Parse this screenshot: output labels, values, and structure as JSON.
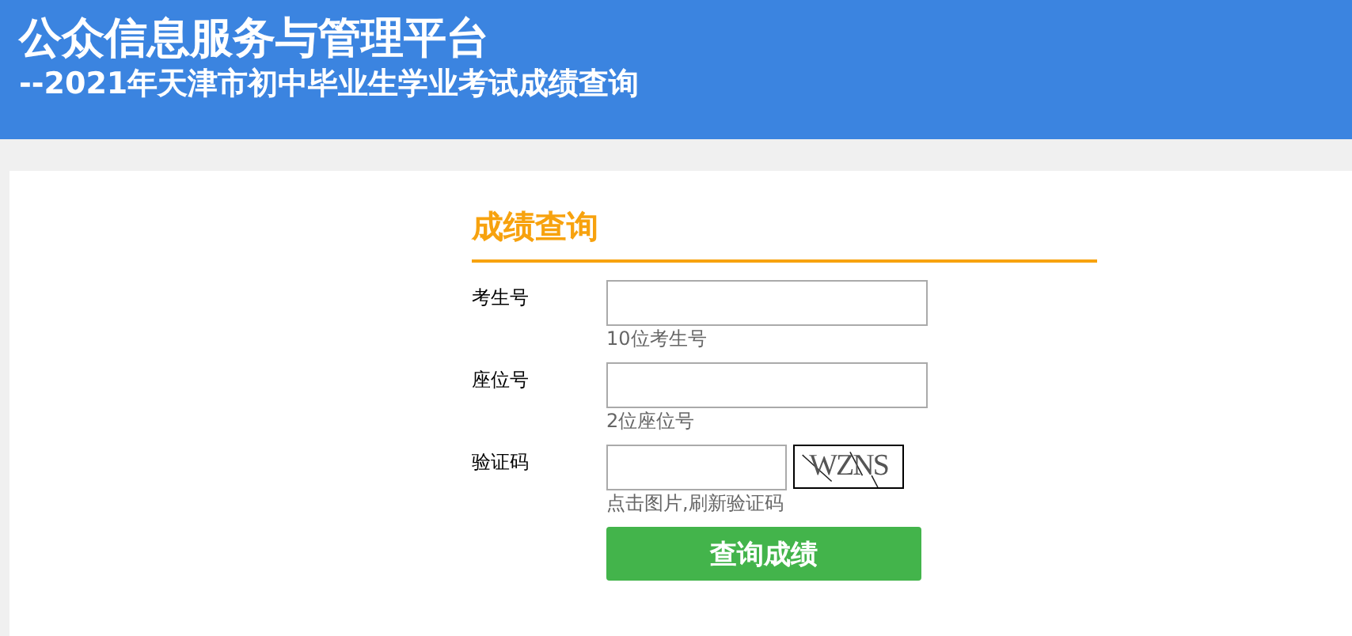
{
  "header": {
    "title": "公众信息服务与管理平台",
    "subtitle": "--2021年天津市初中毕业生学业考试成绩查询"
  },
  "form": {
    "heading": "成绩查询",
    "fields": [
      {
        "kind": "text",
        "label": "考生号",
        "hint": "10位考生号"
      },
      {
        "kind": "captcha_off",
        "label": "座位号",
        "hint": "2位座位号"
      },
      {
        "kind": "captcha",
        "label": "验证码",
        "hint": "点击图片,刷新验证码",
        "captcha": "WZNS"
      }
    ],
    "submit": "查询成绩"
  }
}
